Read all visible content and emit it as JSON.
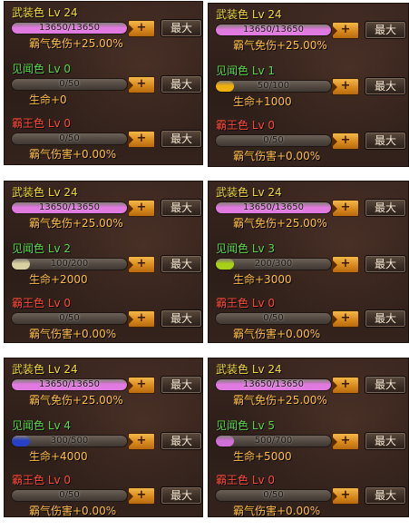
{
  "labels": {
    "plus": "+",
    "max": "最大"
  },
  "panels": [
    {
      "rows": [
        {
          "title": "武装色 Lv 24",
          "bar_text": "13650/13650",
          "stat": "霸气免伤+25.00%",
          "fill": 1.0,
          "fill_color": "#e07ae0"
        },
        {
          "title": "见闻色 Lv 0",
          "bar_text": "0/50",
          "stat": "生命+0",
          "fill": 0.0,
          "fill_color": "#c8c070"
        },
        {
          "title": "霸王色 Lv 0",
          "bar_text": "0/50",
          "stat": "霸气伤害+0.00%",
          "fill": 0.0,
          "fill_color": "#c8c070"
        }
      ]
    },
    {
      "rows": [
        {
          "title": "武装色 Lv 24",
          "bar_text": "13650/13650",
          "stat": "霸气免伤+25.00%",
          "fill": 1.0,
          "fill_color": "#e07ae0"
        },
        {
          "title": "见闻色 Lv 1",
          "bar_text": "50/100",
          "stat": "生命+1000",
          "fill": 0.15,
          "fill_color": "#f0b010"
        },
        {
          "title": "霸王色 Lv 0",
          "bar_text": "0/50",
          "stat": "霸气伤害+0.00%",
          "fill": 0.0,
          "fill_color": "#c8c070"
        }
      ]
    },
    {
      "rows": [
        {
          "title": "武装色 Lv 24",
          "bar_text": "13650/13650",
          "stat": "霸气免伤+25.00%",
          "fill": 1.0,
          "fill_color": "#e07ae0"
        },
        {
          "title": "见闻色 Lv 2",
          "bar_text": "100/200",
          "stat": "生命+2000",
          "fill": 0.15,
          "fill_color": "#d8d0a0"
        },
        {
          "title": "霸王色 Lv 0",
          "bar_text": "0/50",
          "stat": "霸气伤害+0.00%",
          "fill": 0.0,
          "fill_color": "#c8c070"
        }
      ]
    },
    {
      "rows": [
        {
          "title": "武装色 Lv 24",
          "bar_text": "13650/13650",
          "stat": "霸气免伤+25.00%",
          "fill": 1.0,
          "fill_color": "#e07ae0"
        },
        {
          "title": "见闻色 Lv 3",
          "bar_text": "200/300",
          "stat": "生命+3000",
          "fill": 0.15,
          "fill_color": "#a8d018"
        },
        {
          "title": "霸王色 Lv 0",
          "bar_text": "0/50",
          "stat": "霸气伤害+0.00%",
          "fill": 0.0,
          "fill_color": "#c8c070"
        }
      ]
    },
    {
      "rows": [
        {
          "title": "武装色 Lv 24",
          "bar_text": "13650/13650",
          "stat": "霸气免伤+25.00%",
          "fill": 1.0,
          "fill_color": "#e07ae0"
        },
        {
          "title": "见闻色 Lv 4",
          "bar_text": "300/500",
          "stat": "生命+4000",
          "fill": 0.15,
          "fill_color": "#2840c8"
        },
        {
          "title": "霸王色 Lv 0",
          "bar_text": "0/50",
          "stat": "霸气伤害+0.00%",
          "fill": 0.0,
          "fill_color": "#c8c070"
        }
      ]
    },
    {
      "rows": [
        {
          "title": "武装色 Lv 24",
          "bar_text": "13650/13650",
          "stat": "霸气免伤+25.00%",
          "fill": 1.0,
          "fill_color": "#e07ae0"
        },
        {
          "title": "见闻色 Lv 5",
          "bar_text": "500/700",
          "stat": "生命+5000",
          "fill": 0.15,
          "fill_color": "#d070d8"
        },
        {
          "title": "霸王色 Lv 0",
          "bar_text": "0/50",
          "stat": "霸气伤害+0.00%",
          "fill": 0.0,
          "fill_color": "#c8c070"
        }
      ]
    }
  ]
}
